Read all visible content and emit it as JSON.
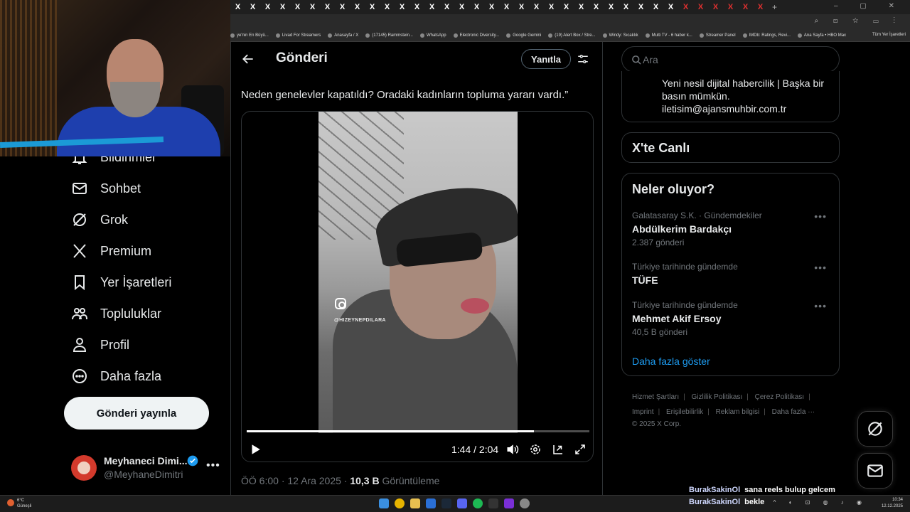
{
  "browser": {
    "tabs": [
      "X",
      "X",
      "X",
      "X",
      "X",
      "X",
      "X",
      "X",
      "X",
      "X",
      "X",
      "X",
      "X",
      "X",
      "X",
      "X",
      "X",
      "X",
      "X",
      "X",
      "X",
      "X",
      "X",
      "X",
      "X",
      "X",
      "X",
      "X",
      "X",
      "X",
      "X",
      "X",
      "X",
      "X",
      "X",
      "X"
    ],
    "new_tab": "+",
    "bookmarks": [
      "ye'nin En Büyü...",
      "Livad For Streamers",
      "Anasayfa / X",
      "(17145) Rammstein...",
      "WhatsApp",
      "Electronic Diversity...",
      "Google Gemini",
      "(19) Alert Box / Stre...",
      "Windy: Sıcaklık",
      "Multi TV - 6 haber k...",
      "Streamer Panel",
      "IMDb: Ratings, Revi...",
      "Ana Sayfa • HBO Max"
    ],
    "all_bookmarks": "Tüm Yer İşaretleri"
  },
  "sidebar": {
    "items": [
      {
        "label": "Bildirimler",
        "icon": "bell-icon"
      },
      {
        "label": "Sohbet",
        "icon": "mail-icon"
      },
      {
        "label": "Grok",
        "icon": "grok-icon"
      },
      {
        "label": "Premium",
        "icon": "x-logo-icon"
      },
      {
        "label": "Yer İşaretleri",
        "icon": "bookmark-icon"
      },
      {
        "label": "Topluluklar",
        "icon": "communities-icon"
      },
      {
        "label": "Profil",
        "icon": "person-icon"
      },
      {
        "label": "Daha fazla",
        "icon": "more-circle-icon"
      }
    ],
    "post_button": "Gönderi yayınla",
    "profile": {
      "name": "Meyhaneci Dimi...",
      "handle": "@MeyhaneDimitri",
      "more": "•••"
    }
  },
  "main": {
    "title": "Gönderi",
    "reply_button": "Yanıtla",
    "tweet_text": "Neden genelevler kapatıldı? Oradaki kadınların topluma yararı vardı.”",
    "video": {
      "watermark": "@HIZEYNEPDILARA",
      "time": "1:44 / 2:04",
      "progress": 0.839
    },
    "meta": {
      "time": "ÖÖ 6:00",
      "sep1": "·",
      "date": "12 Ara 2025",
      "sep2": "·",
      "views_count": "10,3 B",
      "views_label": "Görüntüleme"
    }
  },
  "right": {
    "search_placeholder": "Ara",
    "bio_lines": [
      "Yeni nesil dijital habercilik | Başka bir",
      "basın mümkün.",
      "iletisim@ajansmuhbir.com.tr"
    ],
    "live_title": "X'te Canlı",
    "trends_title": "Neler oluyor?",
    "trends": [
      {
        "context": "Galatasaray S.K. · Gündemdekiler",
        "title": "Abdülkerim Bardakçı",
        "count": "2.387 gönderi"
      },
      {
        "context": "Türkiye tarihinde gündemde",
        "title": "TÜFE",
        "count": ""
      },
      {
        "context": "Türkiye tarihinde gündemde",
        "title": "Mehmet Akif Ersoy",
        "count": "40,5 B gönderi"
      }
    ],
    "show_more": "Daha fazla göster",
    "footer": {
      "links": [
        "Hizmet Şartları",
        "Gizlilik Politikası",
        "Çerez Politikası",
        "Imprint",
        "Erişilebilirlik",
        "Reklam bilgisi",
        "Daha fazla ···"
      ],
      "copyright": "© 2025 X Corp."
    }
  },
  "chat": [
    {
      "user": "BurakSakinOl",
      "message": "sana reels bulup gelcem"
    },
    {
      "user": "BurakSakinOl",
      "message": "bekle"
    }
  ],
  "taskbar": {
    "weather_temp": "6°C",
    "weather_desc": "Güneşli",
    "clock_time": "10:34",
    "clock_date": "12.12.2025"
  },
  "colors": {
    "accent": "#1d9bf0",
    "background": "#000000",
    "text": "#e7e9ea",
    "muted": "#71767b",
    "border": "#2f3336"
  }
}
